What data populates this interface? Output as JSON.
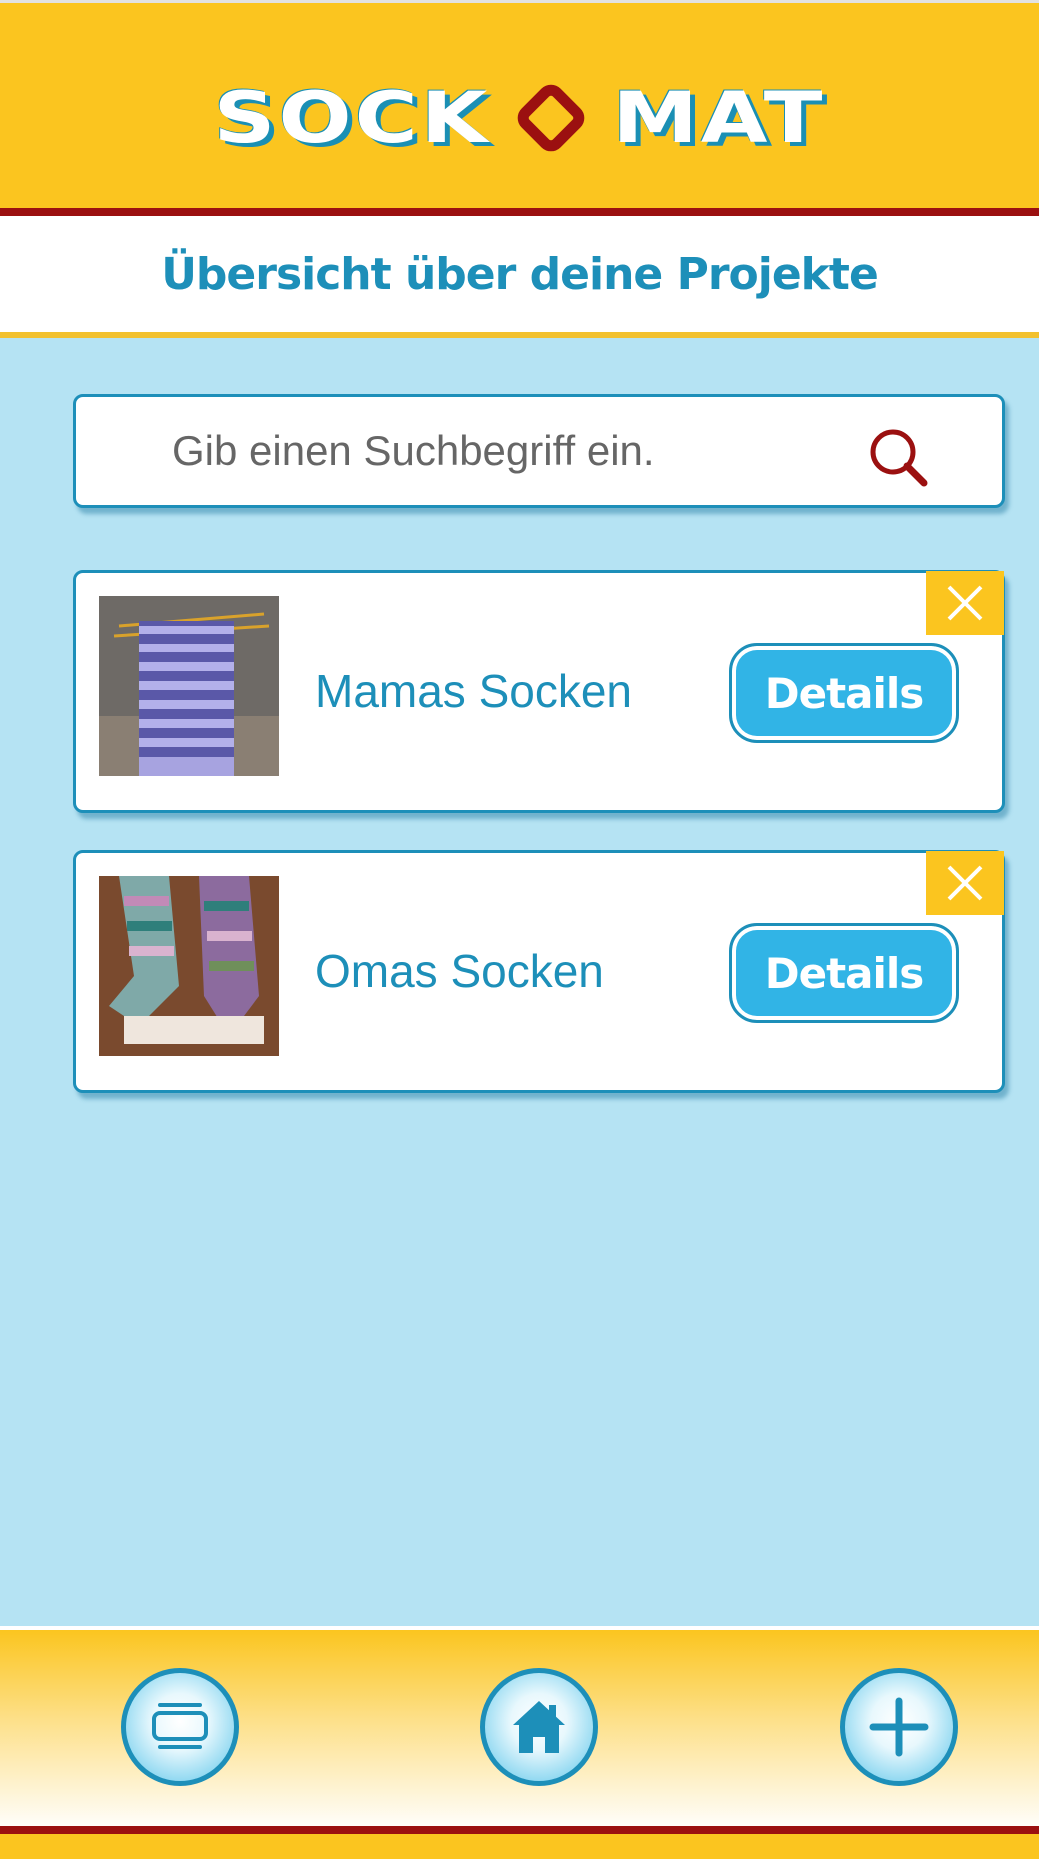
{
  "header": {
    "logo_left": "SOCK",
    "logo_right": "MAT"
  },
  "title": "Übersicht über deine Projekte",
  "search": {
    "placeholder": "Gib einen Suchbegriff ein."
  },
  "projects": [
    {
      "name": "Mamas Socken",
      "details_label": "Details"
    },
    {
      "name": "Omas Socken",
      "details_label": "Details"
    }
  ],
  "footer": {
    "nav": [
      "cards-icon",
      "home-icon",
      "plus-icon"
    ]
  },
  "colors": {
    "header": "#fbc51f",
    "accent": "#1d8fb9",
    "background": "#b5e3f3",
    "button": "#31b4e6",
    "dark_red": "#9b1010"
  }
}
